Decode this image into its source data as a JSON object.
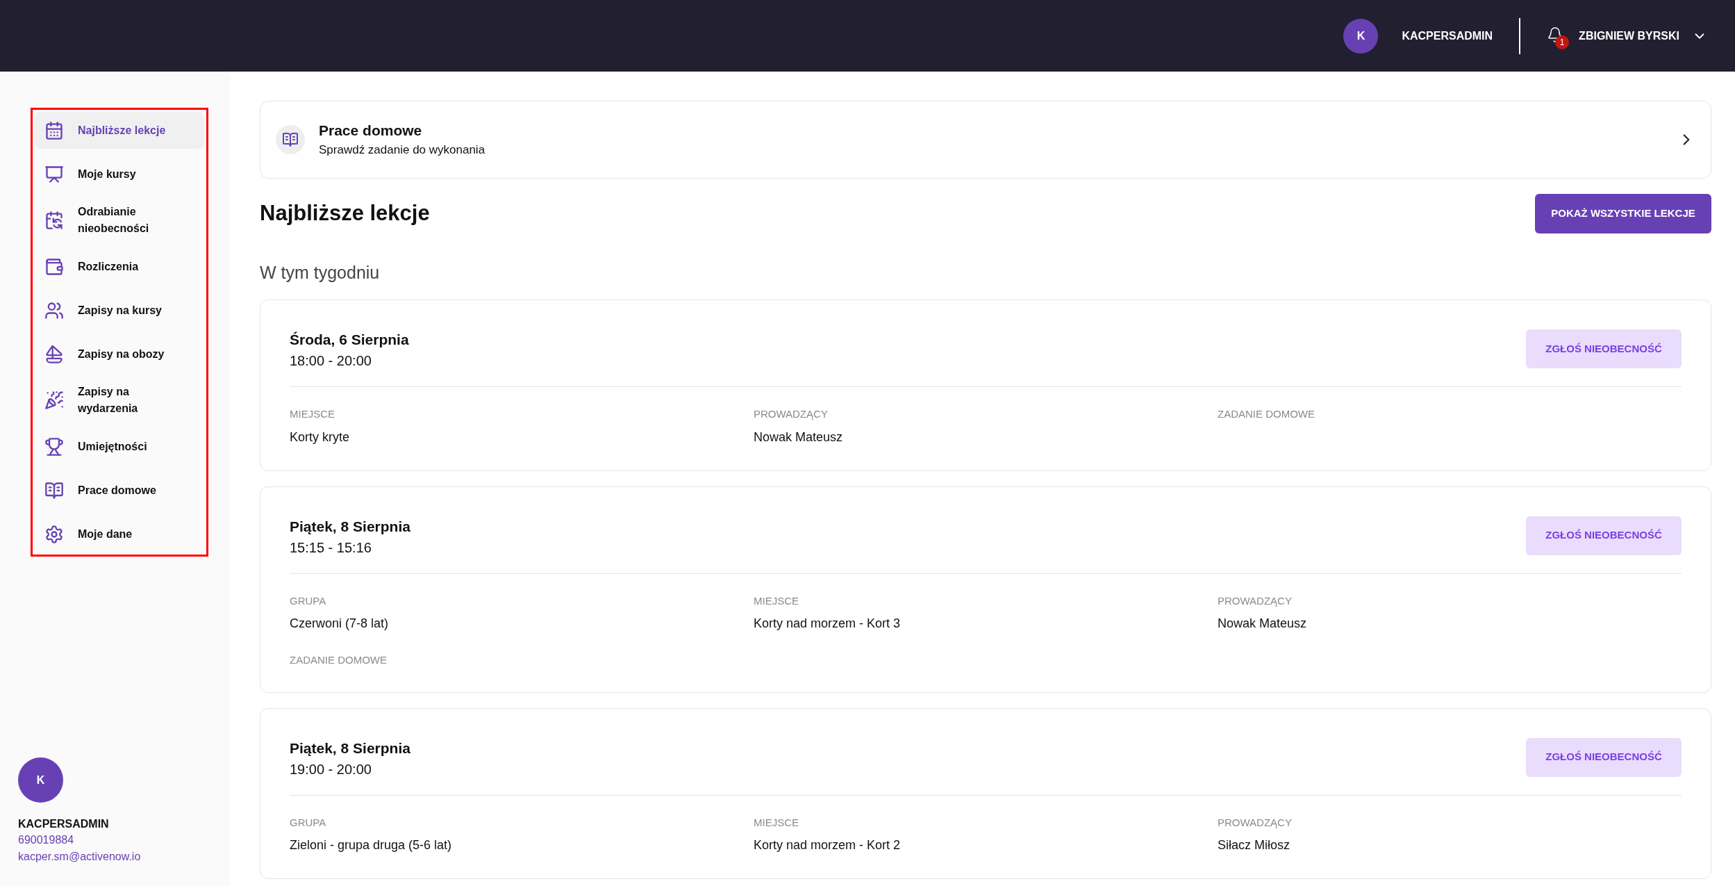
{
  "header": {
    "user_initial": "K",
    "username": "KACPERSADMIN",
    "notifications_count": "1",
    "account_name": "ZBIGNIEW BYRSKI"
  },
  "sidebar": {
    "items": [
      {
        "label": "Najbliższe lekcje",
        "selected": true
      },
      {
        "label": "Moje kursy",
        "selected": false
      },
      {
        "label": "Odrabianie nieobecności",
        "selected": false
      },
      {
        "label": "Rozliczenia",
        "selected": false
      },
      {
        "label": "Zapisy na kursy",
        "selected": false
      },
      {
        "label": "Zapisy na obozy",
        "selected": false
      },
      {
        "label": "Zapisy na wydarzenia",
        "selected": false
      },
      {
        "label": "Umiejętności",
        "selected": false
      },
      {
        "label": "Prace domowe",
        "selected": false
      },
      {
        "label": "Moje dane",
        "selected": false
      }
    ],
    "profile": {
      "initial": "K",
      "username": "KACPERSADMIN",
      "phone": "690019884",
      "email": "kacper.sm@activenow.io"
    }
  },
  "homework_banner": {
    "title": "Prace domowe",
    "subtitle": "Sprawdź zadanie do wykonania"
  },
  "page_title": "Najbliższe lekcje",
  "show_all_button": "POKAŻ WSZYSTKIE LEKCJE",
  "section_title": "W tym tygodniu",
  "lessons": [
    {
      "date": "Środa, 6 Sierpnia",
      "time": "18:00 - 20:00",
      "button": "ZGŁOŚ NIEOBECNOŚĆ",
      "fields": [
        {
          "label": "MIEJSCE",
          "value": "Korty kryte"
        },
        {
          "label": "PROWADZĄCY",
          "value": "Nowak Mateusz"
        },
        {
          "label": "ZADANIE DOMOWE"
        }
      ]
    },
    {
      "date": "Piątek, 8 Sierpnia",
      "time": "15:15 - 15:16",
      "button": "ZGŁOŚ NIEOBECNOŚĆ",
      "fields": [
        {
          "label": "GRUPA",
          "value": "Czerwoni (7-8 lat)"
        },
        {
          "label": "MIEJSCE",
          "value": "Korty nad morzem - Kort 3"
        },
        {
          "label": "PROWADZĄCY",
          "value": "Nowak Mateusz"
        },
        {
          "label": "ZADANIE DOMOWE"
        }
      ]
    },
    {
      "date": "Piątek, 8 Sierpnia",
      "time": "19:00 - 20:00",
      "button": "ZGŁOŚ NIEOBECNOŚĆ",
      "fields": [
        {
          "label": "GRUPA",
          "value": "Zieloni - grupa druga (5-6 lat)"
        },
        {
          "label": "MIEJSCE",
          "value": "Korty nad morzem - Kort 2"
        },
        {
          "label": "PROWADZĄCY",
          "value": "Siłacz Miłosz"
        }
      ]
    }
  ]
}
